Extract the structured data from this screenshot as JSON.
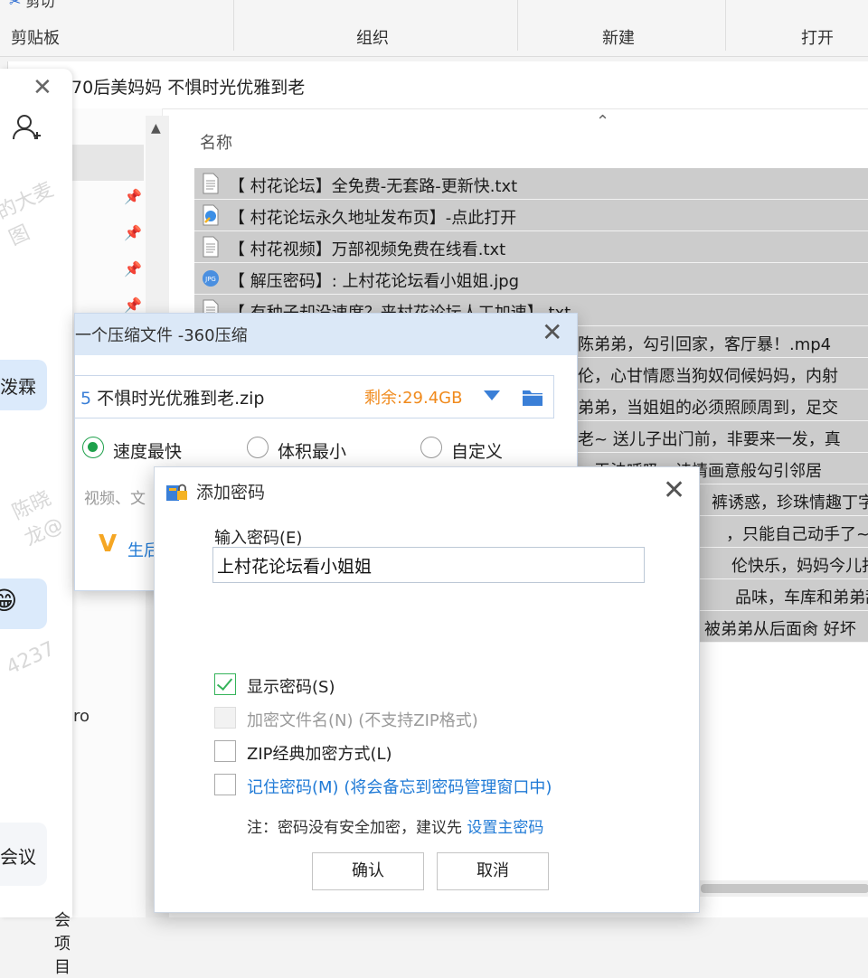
{
  "ribbon": {
    "groups": [
      "剪贴板",
      "组织",
      "新建",
      "打开"
    ],
    "cut_label": "剪切"
  },
  "explorer": {
    "address_title": "70后美妈妈 不惧时光优雅到老",
    "column_name": "名称",
    "nav_fragment": "ro",
    "files": [
      {
        "icon": "txt-file-icon",
        "name": "【 村花论坛】全免费-无套路-更新快.txt"
      },
      {
        "icon": "url-shortcut-icon",
        "name": "【 村花论坛永久地址发布页】-点此打开"
      },
      {
        "icon": "txt-file-icon",
        "name": "【 村花视频】万部视频免费在线看.txt"
      },
      {
        "icon": "jpg-file-icon",
        "name": "【 解压密码】: 上村花论坛看小姐姐.jpg"
      },
      {
        "icon": "txt-file-icon",
        "name": "【 有种子却没速度？来村花论坛人工加速】.txt"
      }
    ],
    "partial_rows": [
      "陈弟弟，勾引回家，客厅暴！.mp4",
      "伦，心甘情愿当狗奴伺候妈妈，内射",
      "弟弟，当姐姐的必须照顾周到，足交",
      "老~ 送儿子出门前，非要来一发，真",
      "，无法呼吸，诗情画意般勾引邻居",
      "裤诱惑，珍珠情趣丁字",
      "，只能自己动手了~.",
      "伦快乐，妈妈今儿打扮",
      "品味，车库和弟弟乱",
      "被弟弟从后面肏 好坏"
    ]
  },
  "chat": {
    "card1_text": "泼霖",
    "card3_text": "会议",
    "bottom_text": "会项目",
    "watermarks": [
      "的大麦图",
      "陈晓龙@",
      "4237"
    ]
  },
  "zip_dialog": {
    "title": "一个压缩文件 -360压缩",
    "file_name": "不惧时光优雅到老.zip",
    "file_prefix": "5",
    "remaining": "剩余:29.4GB",
    "options": [
      "速度最快",
      "体积最小",
      "自定义"
    ],
    "selected_option": "速度最快",
    "hint": "视频、文",
    "vip_text": "生后",
    "blue_frag": "后"
  },
  "password_dialog": {
    "title": "添加密码",
    "input_label": "输入密码(E)",
    "password_value": "上村花论坛看小姐姐",
    "show_password": "显示密码(S)",
    "show_password_checked": true,
    "encrypt_names": "加密文件名(N) (不支持ZIP格式)",
    "encrypt_names_disabled": true,
    "zip_classic": "ZIP经典加密方式(L)",
    "remember_label": "记住密码(M)",
    "remember_note": "(将会备忘到密码管理窗口中)",
    "note_prefix": "注：密码没有安全加密，建议先",
    "note_link": "设置主密码",
    "ok_button": "确认",
    "cancel_button": "取消"
  },
  "colors": {
    "accent_blue": "#1f7ad6",
    "check_green": "#35b35a",
    "remain_orange": "#f08a1c",
    "row_selected": "#cccccc"
  }
}
